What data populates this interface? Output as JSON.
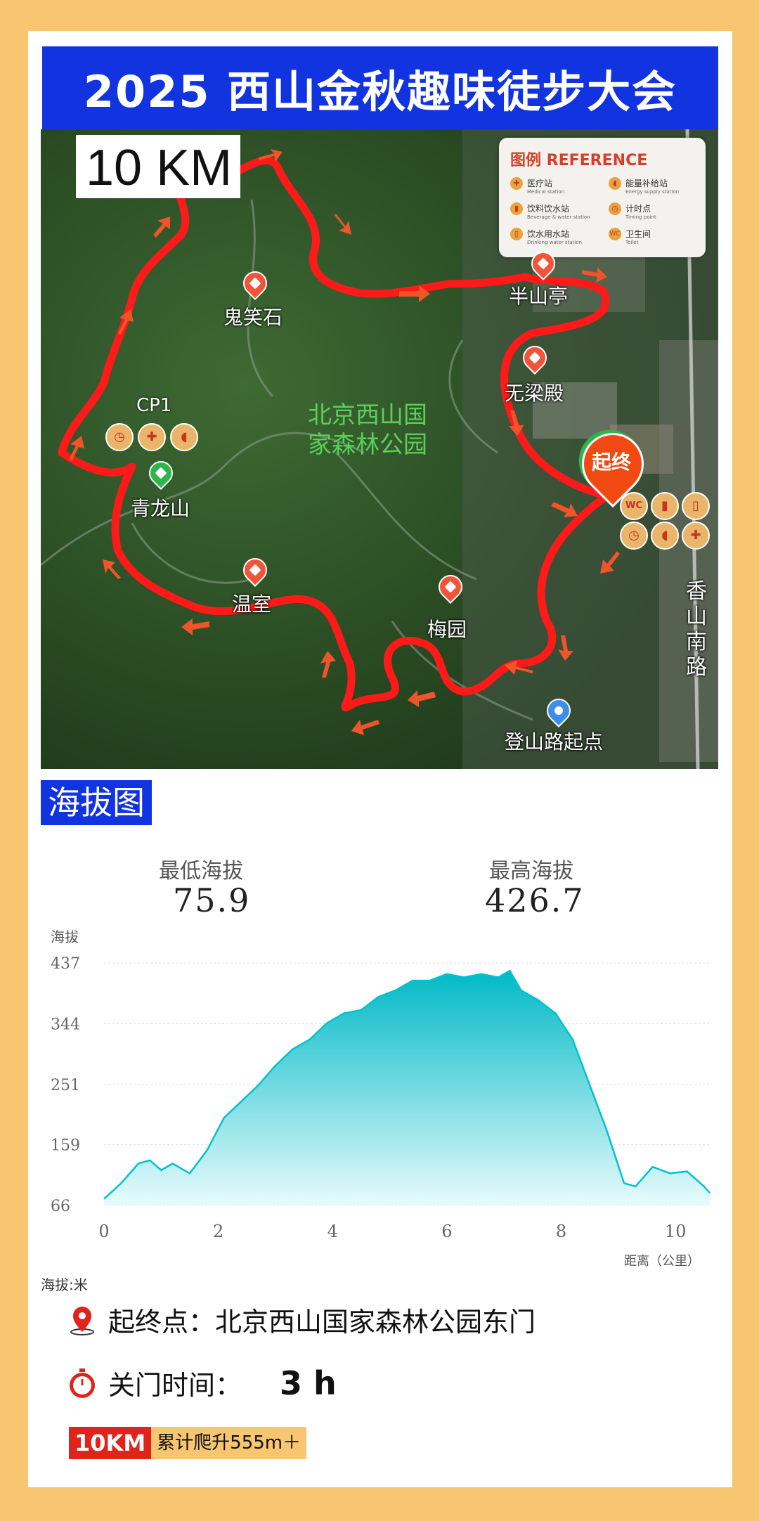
{
  "header": {
    "title": "2025 西山金秋趣味徒步大会"
  },
  "map": {
    "distance_badge": "10 KM",
    "legend": {
      "heading": "图例  REFERENCE",
      "items": [
        {
          "label": "医疗站",
          "sub": "Medical station",
          "icon": "medical-icon"
        },
        {
          "label": "能量补给站",
          "sub": "Energy supply station",
          "icon": "energy-icon"
        },
        {
          "label": "饮料饮水站",
          "sub": "Beverage & water station",
          "icon": "beverage-icon"
        },
        {
          "label": "计时点",
          "sub": "Timing point",
          "icon": "timer-icon"
        },
        {
          "label": "饮水用水站",
          "sub": "Drinking water station",
          "icon": "water-icon"
        },
        {
          "label": "卫生间",
          "sub": "Toilet",
          "icon": "toilet-icon"
        }
      ]
    },
    "places": {
      "guixiaoshi": "鬼笑石",
      "banshanting": "半山亭",
      "wuliangdian": "无梁殿",
      "park": "北京西山国家森林公园",
      "qinglongshan": "青龙山",
      "wenshi": "温室",
      "meiyuan": "梅园",
      "dengshanlu": "登山路起点",
      "road": "香山南路",
      "checkpoint": "CP1",
      "start_end": "起终"
    },
    "colors": {
      "route": "#ff1a1a",
      "arrow": "#f0542a",
      "terrain": "#2d4f26"
    }
  },
  "elevation": {
    "section_title": "海拔图",
    "min_label": "最低海拔",
    "min_value": "75.9",
    "max_label": "最高海拔",
    "max_value": "426.7",
    "unit_note": "海拔:米"
  },
  "chart_data": {
    "type": "area",
    "ylabel": "海拔",
    "xlabel": "距离（公里）",
    "ylim": [
      66,
      437
    ],
    "xlim": [
      0,
      10.6
    ],
    "yticks": [
      437,
      344,
      251,
      159,
      66
    ],
    "xticks": [
      0,
      2,
      4,
      6,
      8,
      10
    ],
    "x": [
      0,
      0.3,
      0.6,
      0.8,
      1.0,
      1.2,
      1.5,
      1.8,
      2.1,
      2.4,
      2.7,
      3.0,
      3.3,
      3.6,
      3.9,
      4.2,
      4.5,
      4.8,
      5.1,
      5.4,
      5.7,
      6.0,
      6.3,
      6.6,
      6.9,
      7.1,
      7.3,
      7.6,
      7.9,
      8.2,
      8.5,
      8.8,
      9.1,
      9.3,
      9.6,
      9.9,
      10.2,
      10.5,
      10.6
    ],
    "y": [
      76,
      100,
      130,
      135,
      120,
      130,
      115,
      150,
      200,
      225,
      250,
      280,
      305,
      320,
      345,
      360,
      365,
      385,
      395,
      410,
      410,
      420,
      415,
      420,
      415,
      425,
      395,
      380,
      360,
      320,
      250,
      180,
      100,
      95,
      125,
      115,
      118,
      95,
      85
    ],
    "grid": true,
    "fill": "#00c2cf"
  },
  "info": {
    "start_label": "起终点：北京西山国家森林公园东门",
    "close_label": "关门时间：",
    "close_value": "3 h",
    "tag_distance": "10KM",
    "tag_climb": "累计爬升555m＋"
  }
}
